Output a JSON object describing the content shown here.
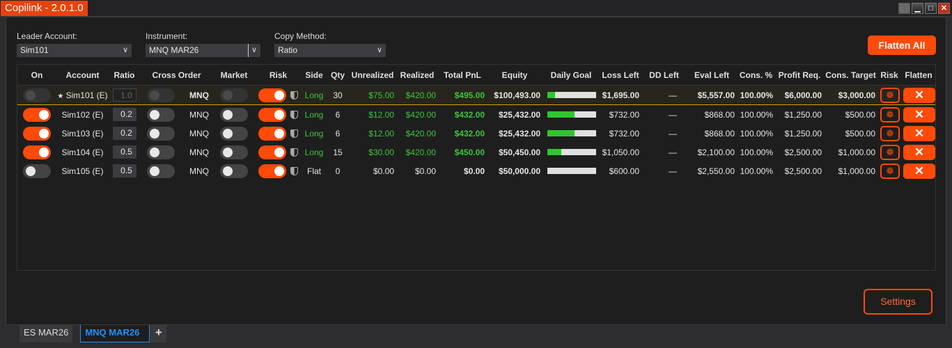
{
  "window": {
    "title": "Copilink - 2.0.1.0",
    "buttons": [
      "▒",
      "▁",
      "□",
      "✕"
    ]
  },
  "controls": {
    "leader_label": "Leader Account:",
    "leader_value": "Sim101",
    "instrument_label": "Instrument:",
    "instrument_value": "MNQ MAR26",
    "copy_label": "Copy Method:",
    "copy_value": "Ratio",
    "flatten_all": "Flatten All",
    "settings": "Settings"
  },
  "columns": [
    "On",
    "Account",
    "Ratio",
    "Cross Order",
    "Market",
    "Risk",
    "Side",
    "Qty",
    "Unrealized",
    "Realized",
    "Total PnL",
    "Equity",
    "Daily Goal",
    "Loss Left",
    "DD Left",
    "Eval Left",
    "Cons. %",
    "Profit Req.",
    "Cons. Target",
    "Risk",
    "Flatten"
  ],
  "rows": [
    {
      "on": false,
      "account": "Sim101 (E)",
      "leader": true,
      "star": "★",
      "ratio": "1.0",
      "cross": false,
      "symbol": "MNQ",
      "market": false,
      "risk": true,
      "side": "Long",
      "qty": "30",
      "unrealized": "$75.00",
      "realized": "$420.00",
      "total": "$495.00",
      "equity": "$100,493.00",
      "goal": 0.15,
      "loss_left": "$1,695.00",
      "dd_left": "—",
      "eval_left": "$5,557.00",
      "cons_pct": "100.00%",
      "profit_req": "$6,000.00",
      "cons_target": "$3,000.00"
    },
    {
      "on": true,
      "account": "Sim102 (E)",
      "ratio": "0.2",
      "cross": false,
      "symbol": "MNQ",
      "market": false,
      "risk": true,
      "side": "Long",
      "qty": "6",
      "unrealized": "$12.00",
      "realized": "$420.00",
      "total": "$432.00",
      "equity": "$25,432.00",
      "goal": 0.55,
      "loss_left": "$732.00",
      "dd_left": "—",
      "eval_left": "$868.00",
      "cons_pct": "100.00%",
      "profit_req": "$1,250.00",
      "cons_target": "$500.00"
    },
    {
      "on": true,
      "account": "Sim103 (E)",
      "ratio": "0.2",
      "cross": false,
      "symbol": "MNQ",
      "market": false,
      "risk": true,
      "side": "Long",
      "qty": "6",
      "unrealized": "$12.00",
      "realized": "$420.00",
      "total": "$432.00",
      "equity": "$25,432.00",
      "goal": 0.55,
      "loss_left": "$732.00",
      "dd_left": "—",
      "eval_left": "$868.00",
      "cons_pct": "100.00%",
      "profit_req": "$1,250.00",
      "cons_target": "$500.00"
    },
    {
      "on": true,
      "account": "Sim104 (E)",
      "ratio": "0.5",
      "cross": false,
      "symbol": "MNQ",
      "market": false,
      "risk": true,
      "side": "Long",
      "qty": "15",
      "unrealized": "$30.00",
      "realized": "$420.00",
      "total": "$450.00",
      "equity": "$50,450.00",
      "goal": 0.28,
      "loss_left": "$1,050.00",
      "dd_left": "—",
      "eval_left": "$2,100.00",
      "cons_pct": "100.00%",
      "profit_req": "$2,500.00",
      "cons_target": "$1,000.00"
    },
    {
      "on": false,
      "account": "Sim105 (E)",
      "ratio": "0.5",
      "cross": false,
      "symbol": "MNQ",
      "market": false,
      "risk": true,
      "side": "Flat",
      "qty": "0",
      "unrealized": "$0.00",
      "realized": "$0.00",
      "total": "$0.00",
      "equity": "$50,000.00",
      "goal": 0,
      "loss_left": "$600.00",
      "dd_left": "—",
      "eval_left": "$2,550.00",
      "cons_pct": "100.00%",
      "profit_req": "$2,500.00",
      "cons_target": "$1,000.00"
    }
  ],
  "icons": {
    "risk": "❁",
    "flatten": "✕"
  },
  "tabs": [
    {
      "label": "ES MAR26",
      "active": false
    },
    {
      "label": "MNQ MAR26",
      "active": true
    }
  ],
  "add_tab": "+"
}
